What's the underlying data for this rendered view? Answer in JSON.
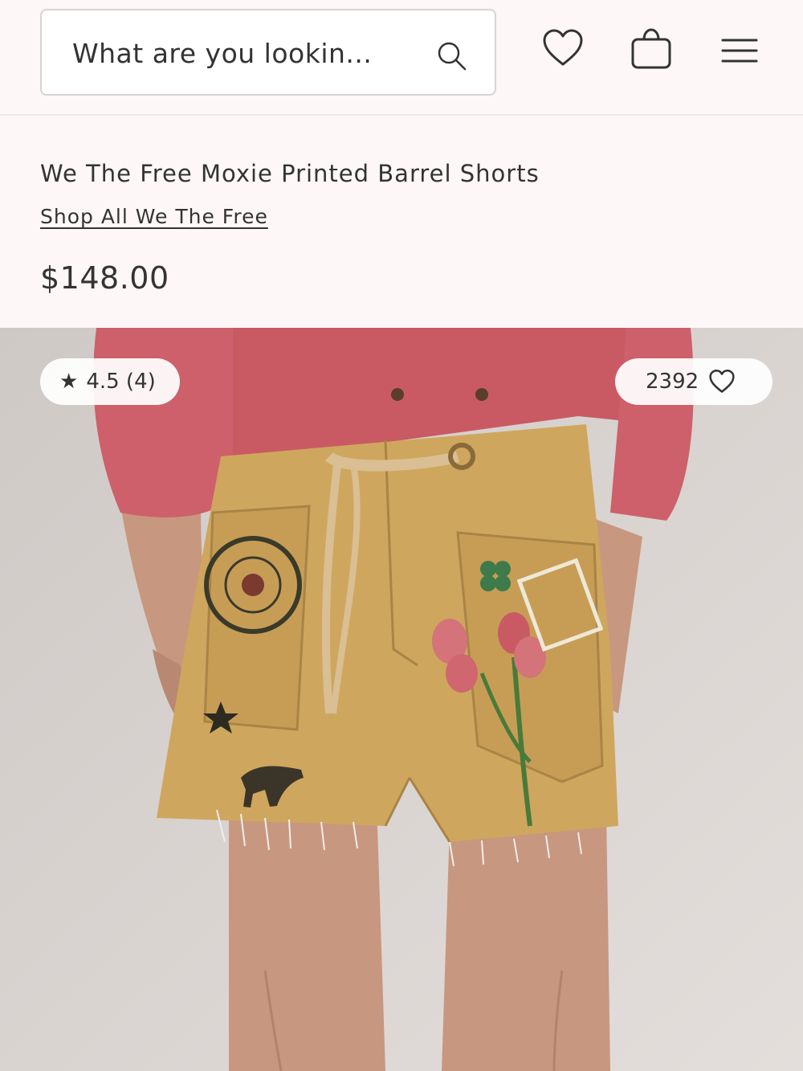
{
  "header": {
    "search_placeholder": "What are you lookin...",
    "icons": [
      "search-icon",
      "heart-icon",
      "bag-icon",
      "menu-icon"
    ]
  },
  "product": {
    "title": "We The Free Moxie Printed Barrel Shorts",
    "brand_link": "Shop All We The Free",
    "price": "$148.00"
  },
  "image_overlay": {
    "rating": "4.5 (4)",
    "favorites": "2392"
  },
  "colors": {
    "background": "#fdf8f7",
    "text": "#333333",
    "jacket": "#c95a63",
    "shorts": "#cfa65e"
  }
}
